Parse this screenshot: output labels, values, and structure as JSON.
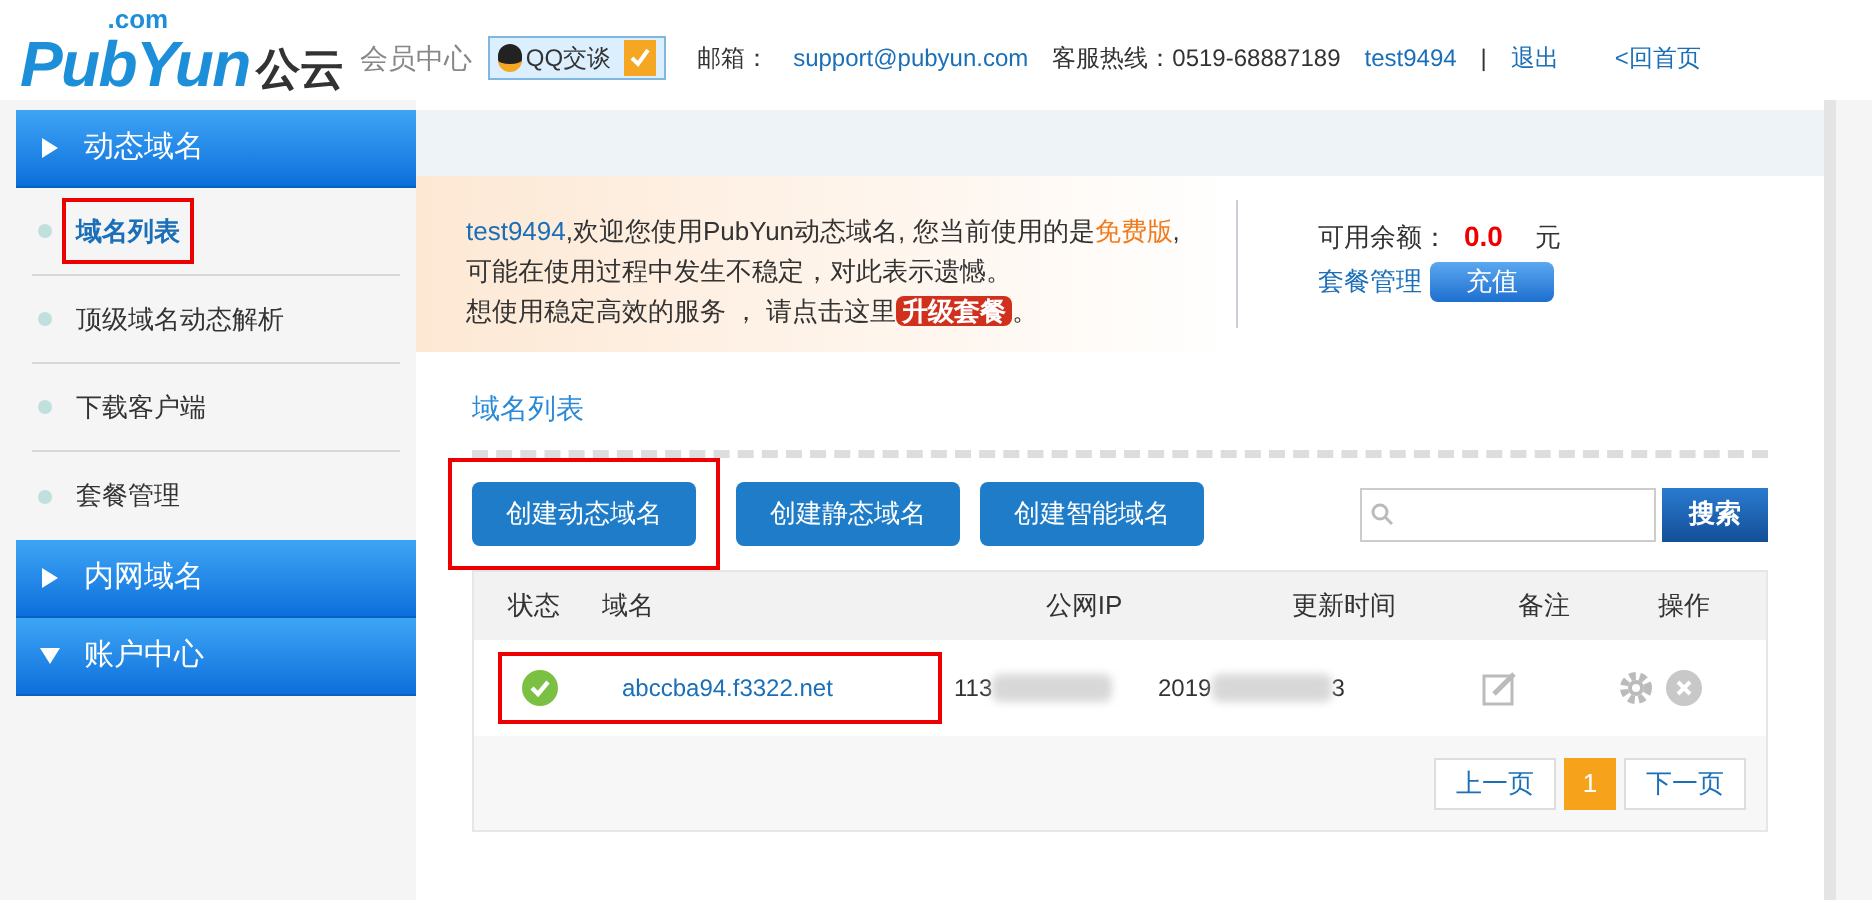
{
  "header": {
    "logo": {
      "name": "PubYun",
      "suffix": ".com",
      "cn": "公云"
    },
    "subtitle": "会员中心",
    "qq_button": "QQ交谈",
    "email_label": "邮箱：",
    "email": "support@pubyun.com",
    "hotline": "客服热线：0519-68887189",
    "user": "test9494",
    "separator": "|",
    "logout": "退出",
    "home": "<回首页"
  },
  "sidebar": [
    {
      "label": "动态域名",
      "expanded": false,
      "children": [
        {
          "label": "域名列表",
          "selected": true,
          "highlighted": true
        },
        {
          "label": "顶级域名动态解析",
          "selected": false,
          "highlighted": false
        },
        {
          "label": "下载客户端",
          "selected": false,
          "highlighted": false
        },
        {
          "label": "套餐管理",
          "selected": false,
          "highlighted": false
        }
      ]
    },
    {
      "label": "内网域名",
      "expanded": false
    },
    {
      "label": "账户中心",
      "expanded": true
    }
  ],
  "notice": {
    "user": "test9494",
    "line1": ",欢迎您使用PubYun动态域名, 您当前使用的是",
    "plan": "免费版",
    "line1_end": ",",
    "line2": "可能在使用过程中发生不稳定，对此表示遗憾。",
    "line3": "想使用稳定高效的服务 ， 请点击这里",
    "upgrade": "升级套餐",
    "line3_end": "。"
  },
  "balance": {
    "label": "可用余额：",
    "amount": "0.0",
    "unit": "元",
    "manage": "套餐管理",
    "recharge": "充值"
  },
  "section_title": "域名列表",
  "actions": [
    {
      "label": "创建动态域名",
      "highlighted": true
    },
    {
      "label": "创建静态域名",
      "highlighted": false
    },
    {
      "label": "创建智能域名",
      "highlighted": false
    }
  ],
  "search": {
    "button": "搜索"
  },
  "table": {
    "columns": [
      "状态",
      "域名",
      "公网IP",
      "更新时间",
      "备注",
      "操作"
    ],
    "rows": [
      {
        "status_ok": true,
        "domain": "abccba94.f3322.net",
        "ip": "113",
        "time_start": "2019",
        "time_end": "3",
        "highlighted": true
      }
    ]
  },
  "pagination": {
    "prev": "上一页",
    "pages": [
      {
        "label": "1",
        "selected": true
      }
    ],
    "next": "下一页"
  }
}
